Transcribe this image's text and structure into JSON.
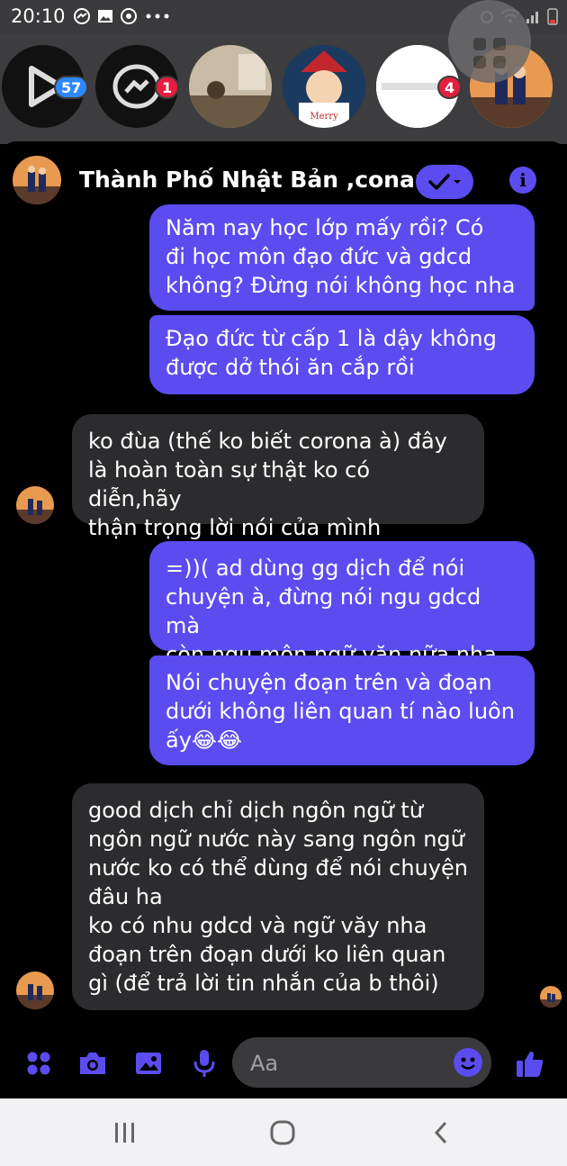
{
  "status_bar": {
    "time": "20:10"
  },
  "chat_heads": {
    "badges": [
      "57",
      "1",
      "4"
    ]
  },
  "header": {
    "title": "Thành Phố Nhật Bản ,conan"
  },
  "messages": [
    {
      "dir": "out",
      "text": "Năm  nay học lớp mấy rồi? Có\nđi học môn đạo đức và gdcd\nkhông? Đừng nói không học nha"
    },
    {
      "dir": "out",
      "text": "Đạo đức từ cấp 1 là dậy không\nđược dở thói ăn cắp rồi"
    },
    {
      "dir": "in",
      "text": "ko đùa (thế ko biết corona à) đây\nlà hoàn toàn sự thật ko có diễn,hãy\nthận trọng lời nói của mình"
    },
    {
      "dir": "out",
      "text": "=))( ad dùng gg dịch để nói\nchuyện à, đừng nói ngu gdcd mà\ncòn ngu môn ngữ văn nữa nha"
    },
    {
      "dir": "out",
      "text": "Nói chuyện đoạn trên và đoạn\ndưới không liên quan tí nào luôn\nấy😂😂"
    },
    {
      "dir": "in",
      "text": "good dịch chỉ dịch ngôn ngữ từ\nngôn ngữ nước này sang ngôn ngữ\nnước ko có thể dùng để nói chuyện\nđâu ha\nko có nhu gdcd và ngữ văy nha\nđoạn trên đoạn dưới ko liên quan\ngì (để trả lời tin nhắn của b thôi)"
    }
  ],
  "composer": {
    "placeholder": "Aa"
  },
  "colors": {
    "accent": "#5b4cf0",
    "incoming_bubble": "#2c2c2e",
    "background": "#000000",
    "badge_blue": "#2d88ff",
    "badge_red": "#e41e3f"
  },
  "icons": [
    "apps-icon",
    "camera-icon",
    "gallery-icon",
    "microphone-icon",
    "emoji-icon",
    "thumbs-up-icon",
    "info-icon",
    "check-icon",
    "chevron-down-icon"
  ]
}
